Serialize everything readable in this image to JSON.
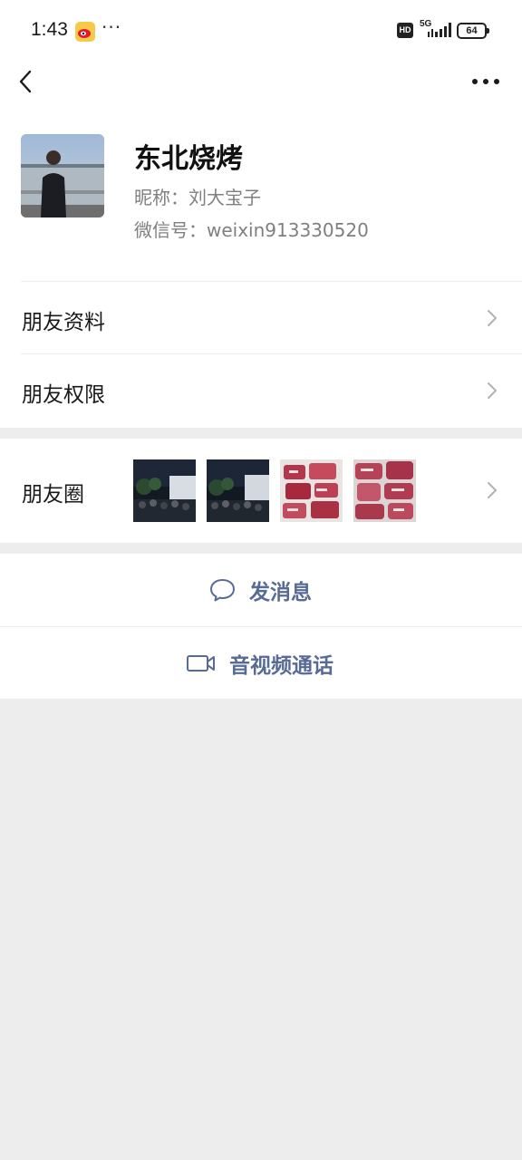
{
  "status_bar": {
    "time": "1:43",
    "dots": "···",
    "hd": "HD",
    "network": "5G",
    "battery": "64"
  },
  "profile": {
    "display_name": "东北烧烤",
    "nickname": "昵称：刘大宝子",
    "wechat_id": "微信号：weixin913330520"
  },
  "menu": {
    "friend_info": "朋友资料",
    "friend_permissions": "朋友权限"
  },
  "moments": {
    "label": "朋友圈",
    "thumbnails": [
      "night-crowd-photo",
      "night-crowd-photo",
      "raw-meat-photo",
      "raw-meat-photo"
    ]
  },
  "actions": {
    "send_message": "发消息",
    "video_call": "音视频通话"
  },
  "colors": {
    "accent_link": "#576b95",
    "background": "#ededed",
    "card": "#ffffff"
  }
}
